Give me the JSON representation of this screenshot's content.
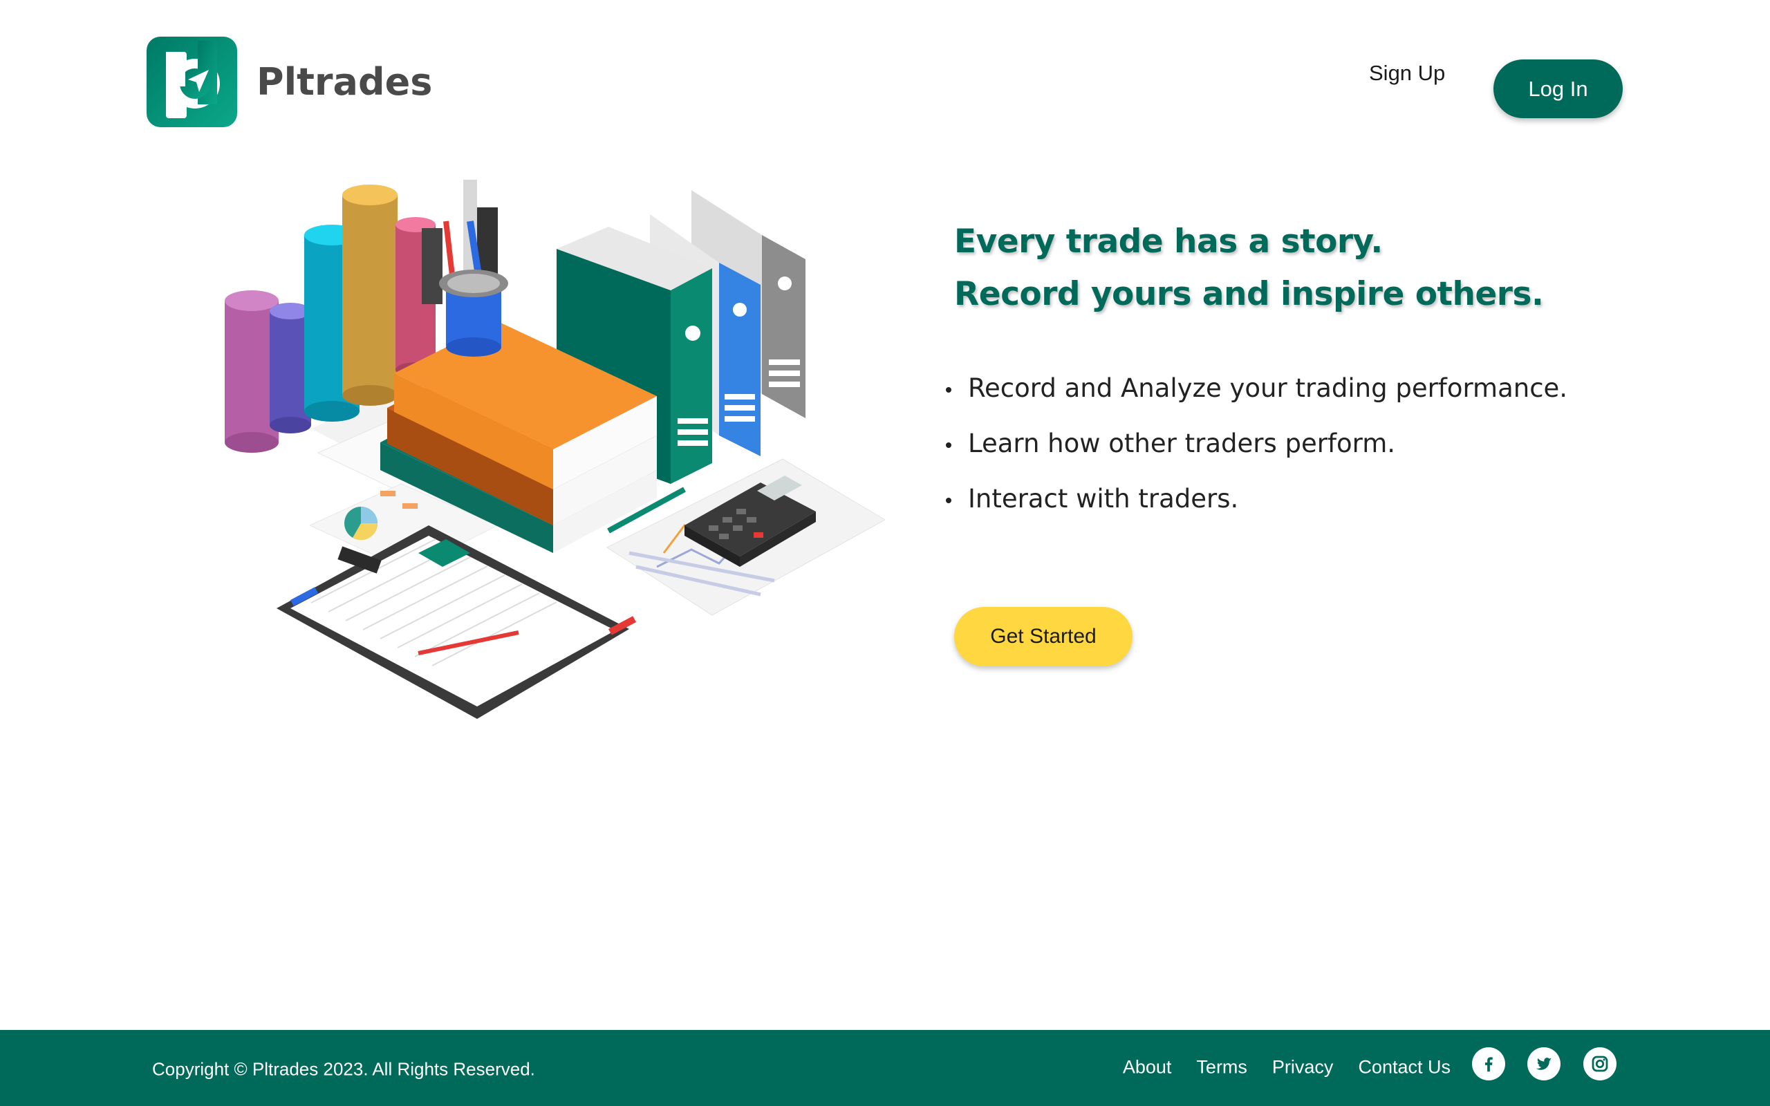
{
  "header": {
    "brand_name": "Pltrades",
    "signup_label": "Sign Up",
    "login_label": "Log In"
  },
  "hero": {
    "headline_line1": "Every trade has a story.",
    "headline_line2": "Record yours and inspire others.",
    "features": [
      "Record and Analyze your trading performance.",
      "Learn how other traders perform.",
      "Interact with traders."
    ],
    "cta_label": "Get Started"
  },
  "footer": {
    "copyright": "Copyright © Pltrades 2023. All Rights Reserved.",
    "links": [
      "About",
      "Terms",
      "Privacy",
      "Contact Us"
    ],
    "social_icons": [
      "facebook-icon",
      "twitter-icon",
      "instagram-icon"
    ]
  },
  "colors": {
    "brand_green": "#006a5a",
    "cta_yellow": "#ffd740",
    "text_dark": "#222222"
  }
}
